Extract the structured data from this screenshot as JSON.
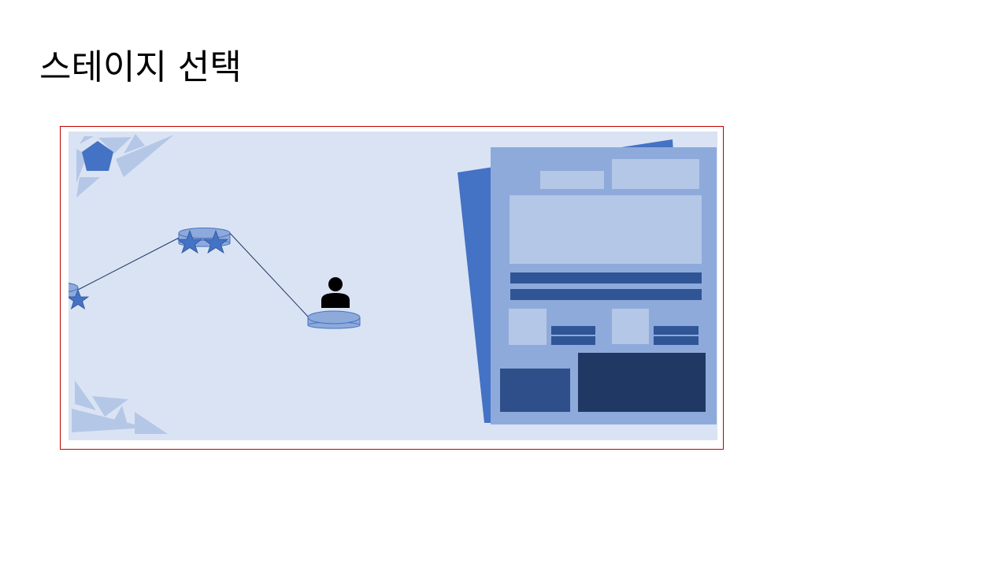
{
  "page": {
    "title": "스테이지 선택"
  },
  "colors": {
    "frame_border": "#c00000",
    "map_background": "#dae3f3",
    "accent_blue": "#4472c4",
    "panel_blue": "#8eaadb",
    "light_block": "#b4c7e7",
    "dark_block": "#2f5597",
    "darkest_block": "#203864"
  },
  "stage_map": {
    "nodes": [
      {
        "name": "stage-1",
        "stars": 1
      },
      {
        "name": "stage-2",
        "stars": 2
      },
      {
        "name": "stage-3",
        "stars": 0,
        "current": true
      }
    ],
    "player_marker": "person-icon"
  },
  "side_panel": {
    "icons": [
      "pentagon-icon"
    ]
  }
}
